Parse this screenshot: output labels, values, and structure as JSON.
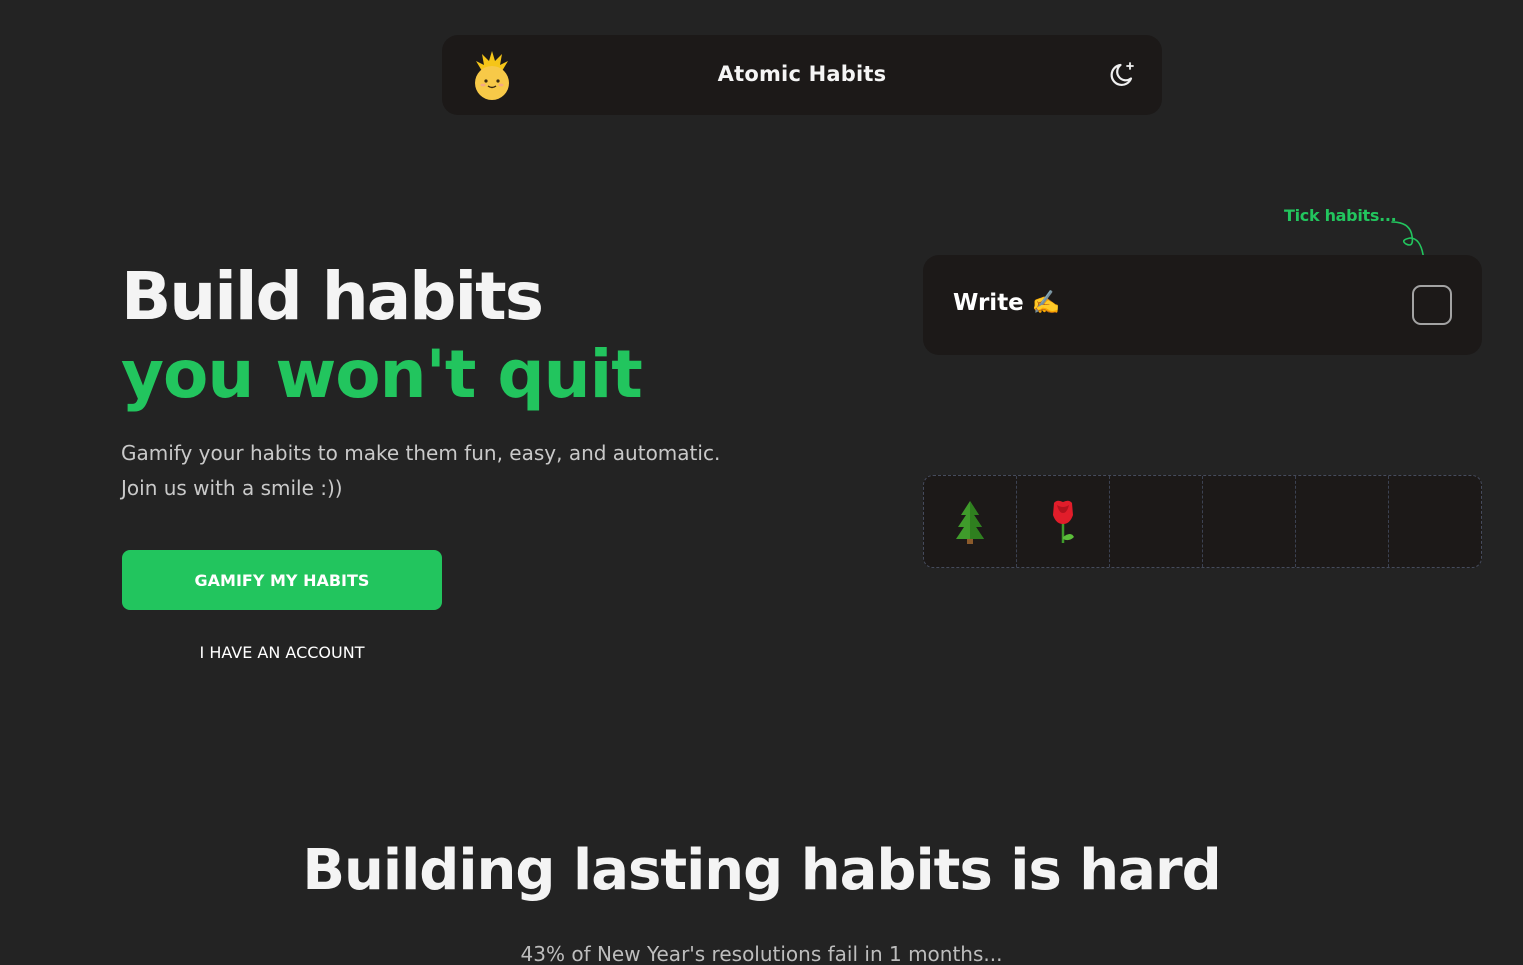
{
  "header": {
    "logo_icon": "pineapple-mascot-icon",
    "title": "Atomic Habits",
    "theme_toggle_icon": "moon-icon"
  },
  "hero": {
    "title_line1": "Build habits",
    "title_line2": "you won't quit",
    "subtitle_line1": "Gamify your habits to make them fun, easy, and automatic.",
    "subtitle_line2": "Join us with a smile :))",
    "primary_button": "GAMIFY MY HABITS",
    "secondary_button": "I HAVE AN ACCOUNT"
  },
  "demo": {
    "annotation": "Tick habits...",
    "habit": {
      "name": "Write ✍️",
      "checked": false
    },
    "garden": {
      "cells": [
        "tree-icon",
        "rose-icon",
        "",
        "",
        "",
        ""
      ]
    }
  },
  "section": {
    "title": "Building lasting habits is hard",
    "subtitle": "43% of New Year's resolutions fail in 1 months..."
  },
  "colors": {
    "background": "#232323",
    "card": "#1c1918",
    "accent": "#22c55e"
  }
}
